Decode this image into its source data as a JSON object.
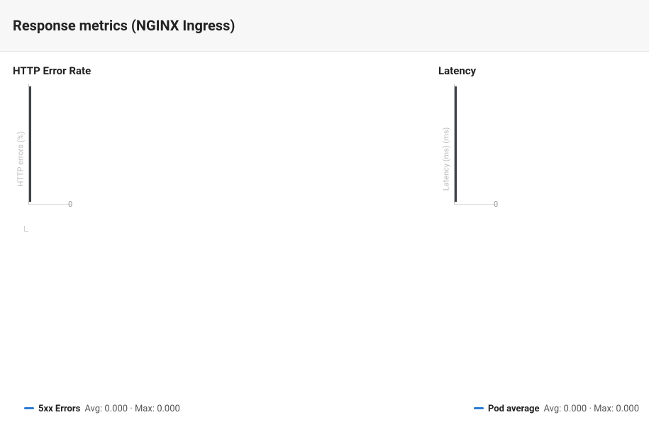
{
  "header": {
    "title": "Response metrics (NGINX Ingress)"
  },
  "charts": {
    "left": {
      "title": "HTTP Error Rate",
      "ylabel": "HTTP errors (%)",
      "tick0": "0",
      "legend": {
        "swatch_color": "#2b7cd3",
        "series_name": "5xx Errors",
        "avg_label": "Avg:",
        "avg_value": "0.000",
        "sep": "·",
        "max_label": "Max:",
        "max_value": "0.000"
      }
    },
    "right": {
      "title": "Latency",
      "ylabel": "Latency (ms) (ms)",
      "tick0": "0",
      "legend": {
        "swatch_color": "#2b7cd3",
        "series_name": "Pod average",
        "avg_label": "Avg:",
        "avg_value": "0.000",
        "sep": "·",
        "max_label": "Max:",
        "max_value": "0.000"
      }
    }
  },
  "chart_data": [
    {
      "type": "line",
      "title": "HTTP Error Rate",
      "xlabel": "",
      "ylabel": "HTTP errors (%)",
      "ylim": [
        0,
        0
      ],
      "series": [
        {
          "name": "5xx Errors",
          "values": [],
          "avg": 0.0,
          "max": 0.0
        }
      ],
      "categories": []
    },
    {
      "type": "line",
      "title": "Latency",
      "xlabel": "",
      "ylabel": "Latency (ms) (ms)",
      "ylim": [
        0,
        0
      ],
      "series": [
        {
          "name": "Pod average",
          "values": [],
          "avg": 0.0,
          "max": 0.0
        }
      ],
      "categories": []
    }
  ]
}
